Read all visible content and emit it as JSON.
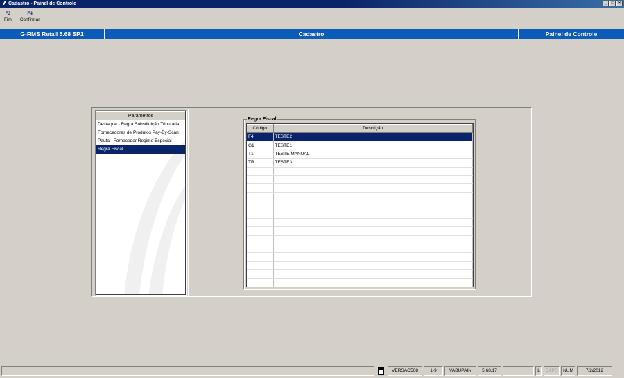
{
  "window": {
    "title": "Cadastro - Painel de Controle",
    "controls": [
      "_",
      "□",
      "×"
    ]
  },
  "function_keys": [
    {
      "key": "F3",
      "label": "Fim"
    },
    {
      "key": "F4",
      "label": "Confirmar"
    }
  ],
  "header": {
    "product": "G-RMS Retail 5.68 SP1",
    "module": "Cadastro",
    "screen": "Painel de Controle"
  },
  "parameters": {
    "header": "Parâmetros",
    "items": [
      "Destaque - Regra Substituição Tributária",
      "Fornecedores de Produtos Pay-By-Scan",
      "Pauta - Fornecedor Regime Especial",
      "Regra Fiscal"
    ],
    "selected_index": 3
  },
  "regra_fiscal": {
    "legend": "Regra Fiscal",
    "columns": [
      "Código",
      "Descrição"
    ],
    "rows": [
      [
        "F4",
        "TESTE2"
      ],
      [
        "G1",
        "TESTE1"
      ],
      [
        "T1",
        "TESTE MANUAL"
      ],
      [
        "TR",
        "TESTE3"
      ]
    ],
    "selected_index": 0,
    "empty_rows": 14
  },
  "status_bar": {
    "version_label": "VERSAO568",
    "page": "1-9",
    "user": "VABUPAIN",
    "build": "5.68.17",
    "blank": "",
    "lock": "L",
    "caps": "CAPS",
    "num": "NUM",
    "date": "7/2/2012"
  },
  "colors": {
    "title_bar": "#0a246a",
    "header_bar": "#0a5cb8",
    "selection": "#0a246a",
    "background": "#d4d0c8"
  }
}
